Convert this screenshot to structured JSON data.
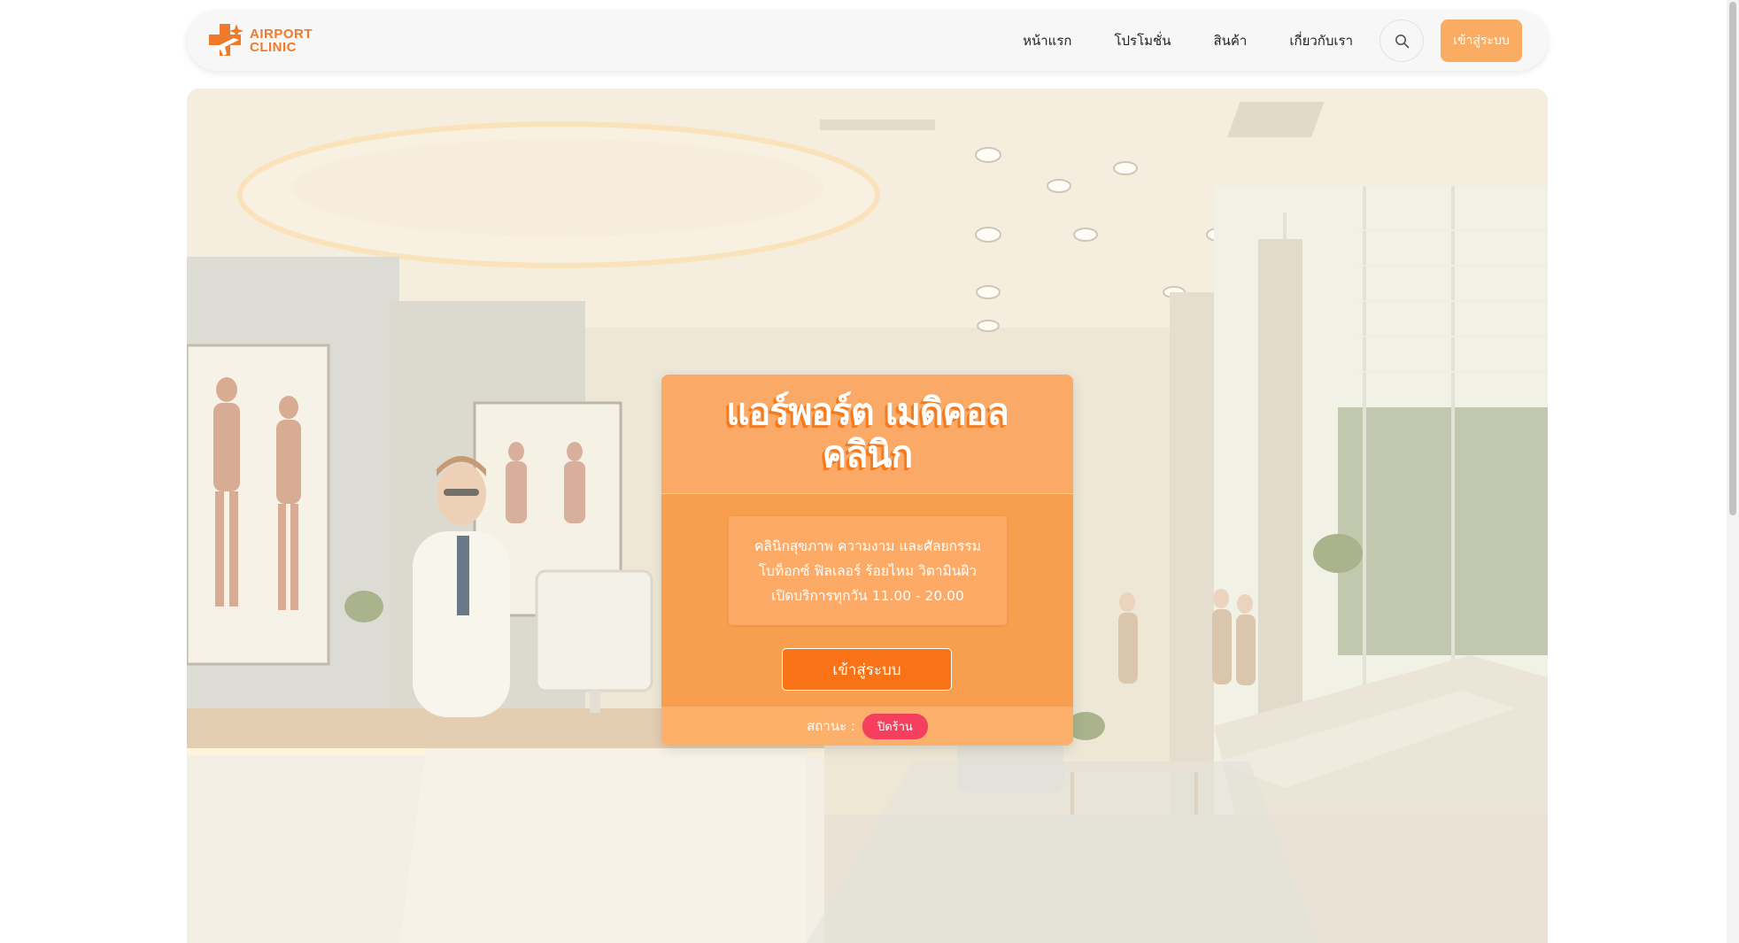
{
  "brand": {
    "logo_line1": "AIRPORT",
    "logo_line2": "CLINIC",
    "accent": "#f07a2b"
  },
  "nav": {
    "items": [
      {
        "label": "หน้าแรก"
      },
      {
        "label": "โปรโมชั่น"
      },
      {
        "label": "สินค้า"
      },
      {
        "label": "เกี่ยวกับเรา"
      }
    ],
    "search_icon": "search-icon",
    "login_label": "เข้าสู่ระบบ"
  },
  "hero": {
    "title_line1": "แอร์พอร์ต เมดิคอล",
    "title_line2": "คลินิก",
    "info_lines": [
      "คลินิกสุขภาพ ความงาม และศัลยกรรม",
      "โบท็อกซ์ ฟิลเลอร์ ร้อยไหม วิตามินผิว",
      "เปิดบริการทุกวัน 11.00 - 20.00"
    ],
    "login_label": "เข้าสู่ระบบ",
    "status_label": "สถานะ :",
    "status_value": "ปิดร้าน",
    "status_color": "#f43f5e"
  }
}
